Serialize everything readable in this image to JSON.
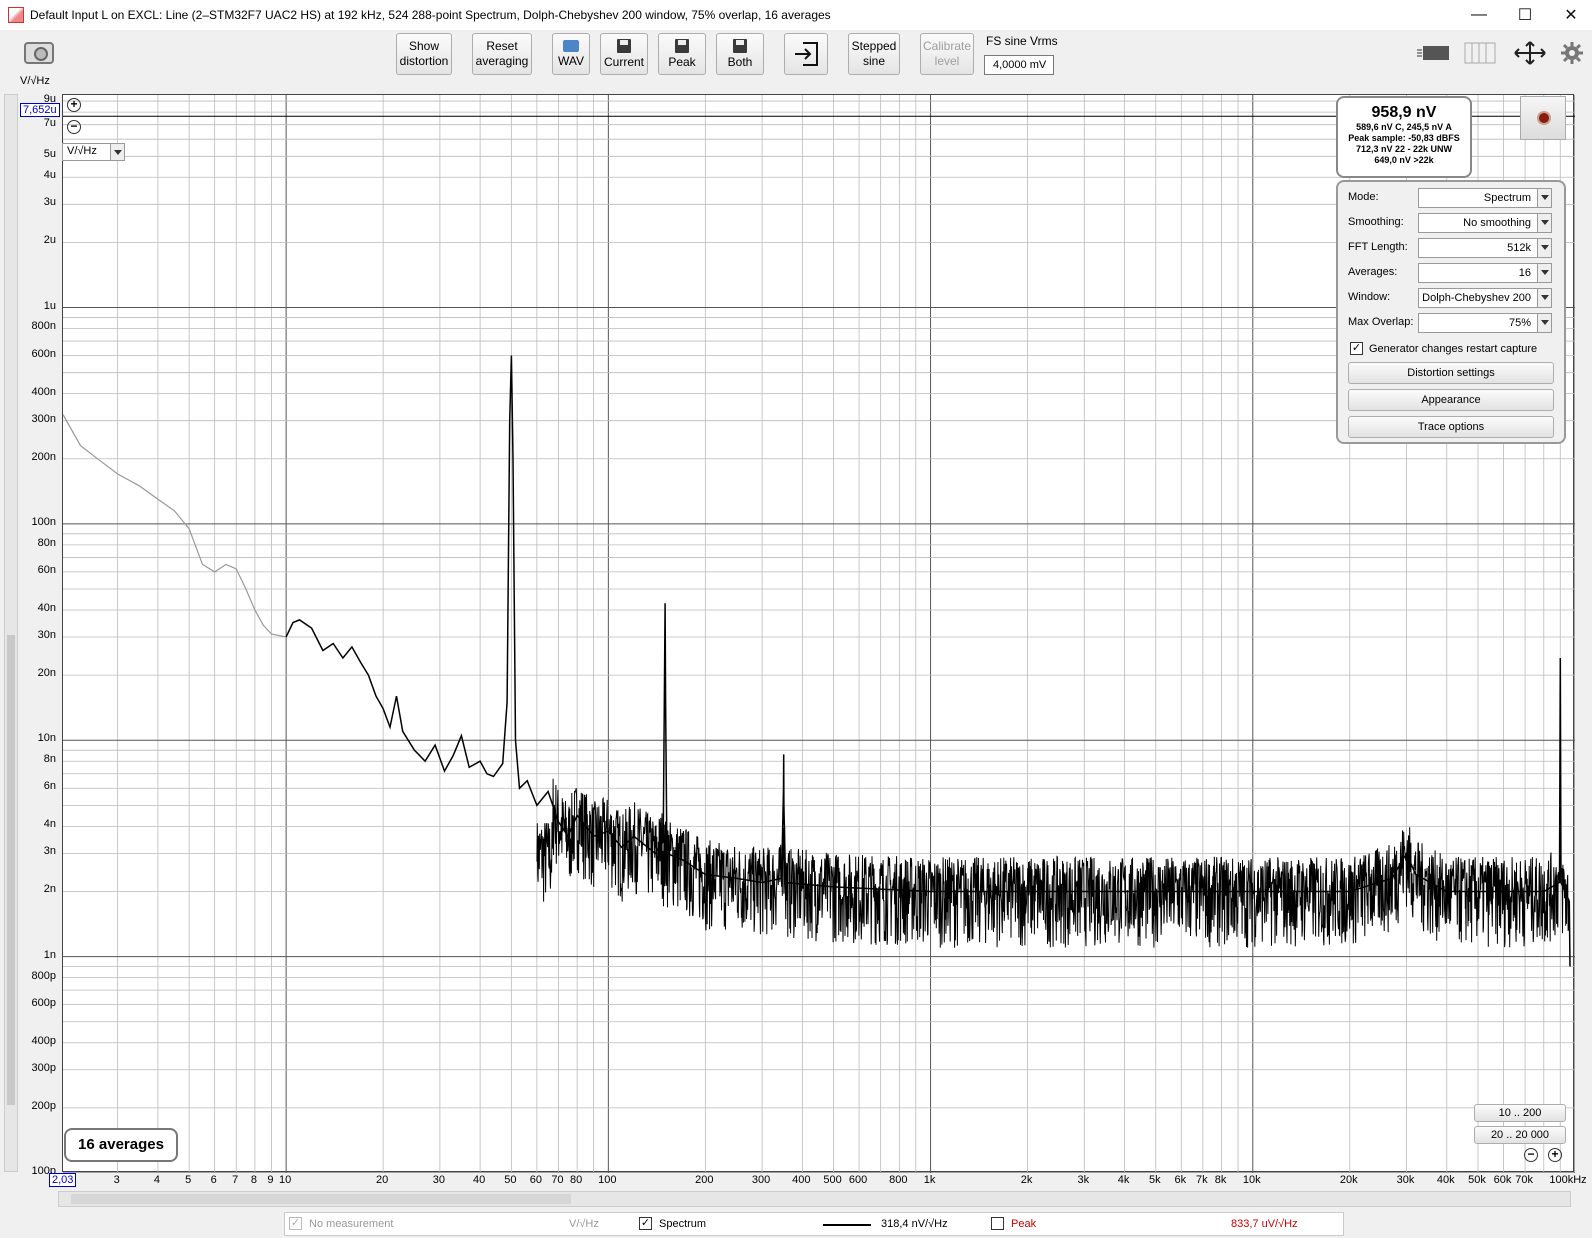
{
  "window": {
    "title": "Default Input L on EXCL: Line (2–STM32F7 UAC2 HS) at 192 kHz, 524 288-point Spectrum, Dolph-Chebyshev 200 window, 75% overlap, 16 averages",
    "minimize": "—",
    "maximize": "☐",
    "close": "✕"
  },
  "toolbar": {
    "show_distortion": [
      "Show",
      "distortion"
    ],
    "reset_averaging": [
      "Reset",
      "averaging"
    ],
    "wav": "WAV",
    "current": "Current",
    "peak": "Peak",
    "both": "Both",
    "stepped_sine": [
      "Stepped",
      "sine"
    ],
    "calibrate_level": [
      "Calibrate",
      "level"
    ],
    "fs_label": "FS sine Vrms",
    "fs_value": "4,0000 mV"
  },
  "axes": {
    "y_unit_label": "V/√Hz",
    "y_cursor_value": "7,652u",
    "x_cursor_value": "2,03",
    "unit_select": "V/√Hz",
    "y_ticks": [
      {
        "label": "9u",
        "value": 9e-06
      },
      {
        "label": "7u",
        "value": 7e-06
      },
      {
        "label": "5u",
        "value": 5e-06
      },
      {
        "label": "4u",
        "value": 4e-06
      },
      {
        "label": "3u",
        "value": 3e-06
      },
      {
        "label": "2u",
        "value": 2e-06
      },
      {
        "label": "1u",
        "value": 1e-06
      },
      {
        "label": "800n",
        "value": 8e-07
      },
      {
        "label": "600n",
        "value": 6e-07
      },
      {
        "label": "400n",
        "value": 4e-07
      },
      {
        "label": "300n",
        "value": 3e-07
      },
      {
        "label": "200n",
        "value": 2e-07
      },
      {
        "label": "100n",
        "value": 1e-07
      },
      {
        "label": "80n",
        "value": 8e-08
      },
      {
        "label": "60n",
        "value": 6e-08
      },
      {
        "label": "40n",
        "value": 4e-08
      },
      {
        "label": "30n",
        "value": 3e-08
      },
      {
        "label": "20n",
        "value": 2e-08
      },
      {
        "label": "10n",
        "value": 1e-08
      },
      {
        "label": "8n",
        "value": 8e-09
      },
      {
        "label": "6n",
        "value": 6e-09
      },
      {
        "label": "4n",
        "value": 4e-09
      },
      {
        "label": "3n",
        "value": 3e-09
      },
      {
        "label": "2n",
        "value": 2e-09
      },
      {
        "label": "1n",
        "value": 1e-09
      },
      {
        "label": "800p",
        "value": 8e-10
      },
      {
        "label": "600p",
        "value": 6e-10
      },
      {
        "label": "400p",
        "value": 4e-10
      },
      {
        "label": "300p",
        "value": 3e-10
      },
      {
        "label": "200p",
        "value": 2e-10
      },
      {
        "label": "100p",
        "value": 1e-10
      }
    ],
    "x_ticks": [
      {
        "label": "3",
        "value": 3
      },
      {
        "label": "4",
        "value": 4
      },
      {
        "label": "5",
        "value": 5
      },
      {
        "label": "6",
        "value": 6
      },
      {
        "label": "7",
        "value": 7
      },
      {
        "label": "8",
        "value": 8
      },
      {
        "label": "9",
        "value": 9
      },
      {
        "label": "10",
        "value": 10
      },
      {
        "label": "20",
        "value": 20
      },
      {
        "label": "30",
        "value": 30
      },
      {
        "label": "40",
        "value": 40
      },
      {
        "label": "50",
        "value": 50
      },
      {
        "label": "60",
        "value": 60
      },
      {
        "label": "70",
        "value": 70
      },
      {
        "label": "80",
        "value": 80
      },
      {
        "label": "100",
        "value": 100
      },
      {
        "label": "200",
        "value": 200
      },
      {
        "label": "300",
        "value": 300
      },
      {
        "label": "400",
        "value": 400
      },
      {
        "label": "500",
        "value": 500
      },
      {
        "label": "600",
        "value": 600
      },
      {
        "label": "800",
        "value": 800
      },
      {
        "label": "1k",
        "value": 1000
      },
      {
        "label": "2k",
        "value": 2000
      },
      {
        "label": "3k",
        "value": 3000
      },
      {
        "label": "4k",
        "value": 4000
      },
      {
        "label": "5k",
        "value": 5000
      },
      {
        "label": "6k",
        "value": 6000
      },
      {
        "label": "7k",
        "value": 7000
      },
      {
        "label": "8k",
        "value": 8000
      },
      {
        "label": "10k",
        "value": 10000
      },
      {
        "label": "20k",
        "value": 20000
      },
      {
        "label": "30k",
        "value": 30000
      },
      {
        "label": "40k",
        "value": 40000
      },
      {
        "label": "50k",
        "value": 50000
      },
      {
        "label": "60k",
        "value": 60000
      },
      {
        "label": "70k",
        "value": 70000
      },
      {
        "label": "100kHz",
        "value": 100000
      }
    ]
  },
  "chart_data": {
    "type": "line",
    "xscale": "log",
    "yscale": "log",
    "xlim": [
      2.03,
      100000
    ],
    "ylim": [
      1e-10,
      9.6e-06
    ],
    "ylabel": "V/√Hz",
    "grid": true,
    "series": [
      {
        "name": "Spectrum",
        "color": "#000000",
        "points": [
          [
            2.03,
            3.2e-07
          ],
          [
            2.3,
            2.3e-07
          ],
          [
            2.6,
            2e-07
          ],
          [
            3,
            1.7e-07
          ],
          [
            3.5,
            1.5e-07
          ],
          [
            4,
            1.3e-07
          ],
          [
            4.5,
            1.15e-07
          ],
          [
            5,
            9.5e-08
          ],
          [
            5.5,
            6.5e-08
          ],
          [
            6,
            6e-08
          ],
          [
            6.5,
            6.5e-08
          ],
          [
            7,
            6.2e-08
          ],
          [
            7.5,
            5e-08
          ],
          [
            8,
            4e-08
          ],
          [
            8.5,
            3.4e-08
          ],
          [
            9,
            3.1e-08
          ],
          [
            10,
            3e-08
          ],
          [
            10.5,
            3.5e-08
          ],
          [
            11,
            3.6e-08
          ],
          [
            12,
            3.3e-08
          ],
          [
            13,
            2.6e-08
          ],
          [
            14,
            2.8e-08
          ],
          [
            15,
            2.4e-08
          ],
          [
            16,
            2.7e-08
          ],
          [
            17,
            2.3e-08
          ],
          [
            18,
            2e-08
          ],
          [
            19,
            1.6e-08
          ],
          [
            20,
            1.4e-08
          ],
          [
            21,
            1.15e-08
          ],
          [
            22,
            1.6e-08
          ],
          [
            23,
            1.1e-08
          ],
          [
            25,
            9e-09
          ],
          [
            27,
            8e-09
          ],
          [
            29,
            9.5e-09
          ],
          [
            31,
            7.2e-09
          ],
          [
            33,
            8.5e-09
          ],
          [
            35,
            1.05e-08
          ],
          [
            37,
            7.5e-09
          ],
          [
            40,
            8e-09
          ],
          [
            42,
            7e-09
          ],
          [
            44,
            6.8e-09
          ],
          [
            47,
            7.8e-09
          ],
          [
            48.5,
            1.5e-08
          ],
          [
            49.4,
            3e-07
          ],
          [
            50,
            6e-07
          ],
          [
            50.6,
            2e-07
          ],
          [
            51.5,
            1e-08
          ],
          [
            53,
            6e-09
          ],
          [
            56,
            6.5e-09
          ],
          [
            60,
            5e-09
          ],
          [
            65,
            5.8e-09
          ],
          [
            70,
            4.2e-09
          ],
          [
            75,
            3.6e-09
          ],
          [
            80,
            4.5e-09
          ],
          [
            90,
            3.6e-09
          ],
          [
            100,
            3.8e-09
          ],
          [
            110,
            3.2e-09
          ],
          [
            120,
            3.6e-09
          ],
          [
            140,
            3e-09
          ],
          [
            148,
            3.4e-09
          ],
          [
            149.5,
            2.2e-08
          ],
          [
            150,
            4.3e-08
          ],
          [
            150.5,
            1.5e-08
          ],
          [
            152,
            3e-09
          ],
          [
            170,
            2.8e-09
          ],
          [
            200,
            2.4e-09
          ],
          [
            250,
            2.3e-09
          ],
          [
            300,
            2.2e-09
          ],
          [
            345,
            2.3e-09
          ],
          [
            349.5,
            6e-09
          ],
          [
            350,
            8.6e-09
          ],
          [
            350.5,
            5e-09
          ],
          [
            355,
            2.2e-09
          ],
          [
            500,
            2.1e-09
          ],
          [
            1000,
            2e-09
          ],
          [
            2000,
            2e-09
          ],
          [
            5000,
            2e-09
          ],
          [
            10000,
            2e-09
          ],
          [
            20000,
            2e-09
          ],
          [
            27000,
            2.3e-09
          ],
          [
            30000,
            3e-09
          ],
          [
            32000,
            2.4e-09
          ],
          [
            40000,
            2e-09
          ],
          [
            80000,
            2e-09
          ],
          [
            89500,
            2.2e-09
          ],
          [
            90000,
            2.4e-08
          ],
          [
            90500,
            2.2e-09
          ],
          [
            96000,
            1.8e-09
          ],
          [
            96500,
            9e-10
          ]
        ]
      }
    ]
  },
  "measurement": {
    "rms": "958,9 nV",
    "line1": "589,6 nV C, 245,5 nV A",
    "line2": "Peak sample: -50,83 dBFS",
    "line3": "712,3 nV 22 - 22k UNW",
    "line4": "649,0 nV >22k"
  },
  "settings": {
    "mode_label": "Mode:",
    "mode_value": "Spectrum",
    "smoothing_label": "Smoothing:",
    "smoothing_value": "No  smoothing",
    "fft_label": "FFT Length:",
    "fft_value": "512k",
    "averages_label": "Averages:",
    "averages_value": "16",
    "window_label": "Window:",
    "window_value": "Dolph-Chebyshev 200",
    "overlap_label": "Max Overlap:",
    "overlap_value": "75%",
    "restart_label": "Generator changes restart capture",
    "restart_checked": true,
    "distortion_btn": "Distortion settings",
    "appearance_btn": "Appearance",
    "trace_btn": "Trace options"
  },
  "status": {
    "averages_badge": "16 averages",
    "range1": "10 .. 200",
    "range2": "20 .. 20 000"
  },
  "legend": {
    "no_measurement": "No measurement",
    "no_measurement_unit": "V/√Hz",
    "spectrum_label": "Spectrum",
    "spectrum_value": "318,4 nV/√Hz",
    "peak_label": "Peak",
    "peak_value": "833,7 uV/√Hz",
    "peak_color": "#cc0000"
  }
}
